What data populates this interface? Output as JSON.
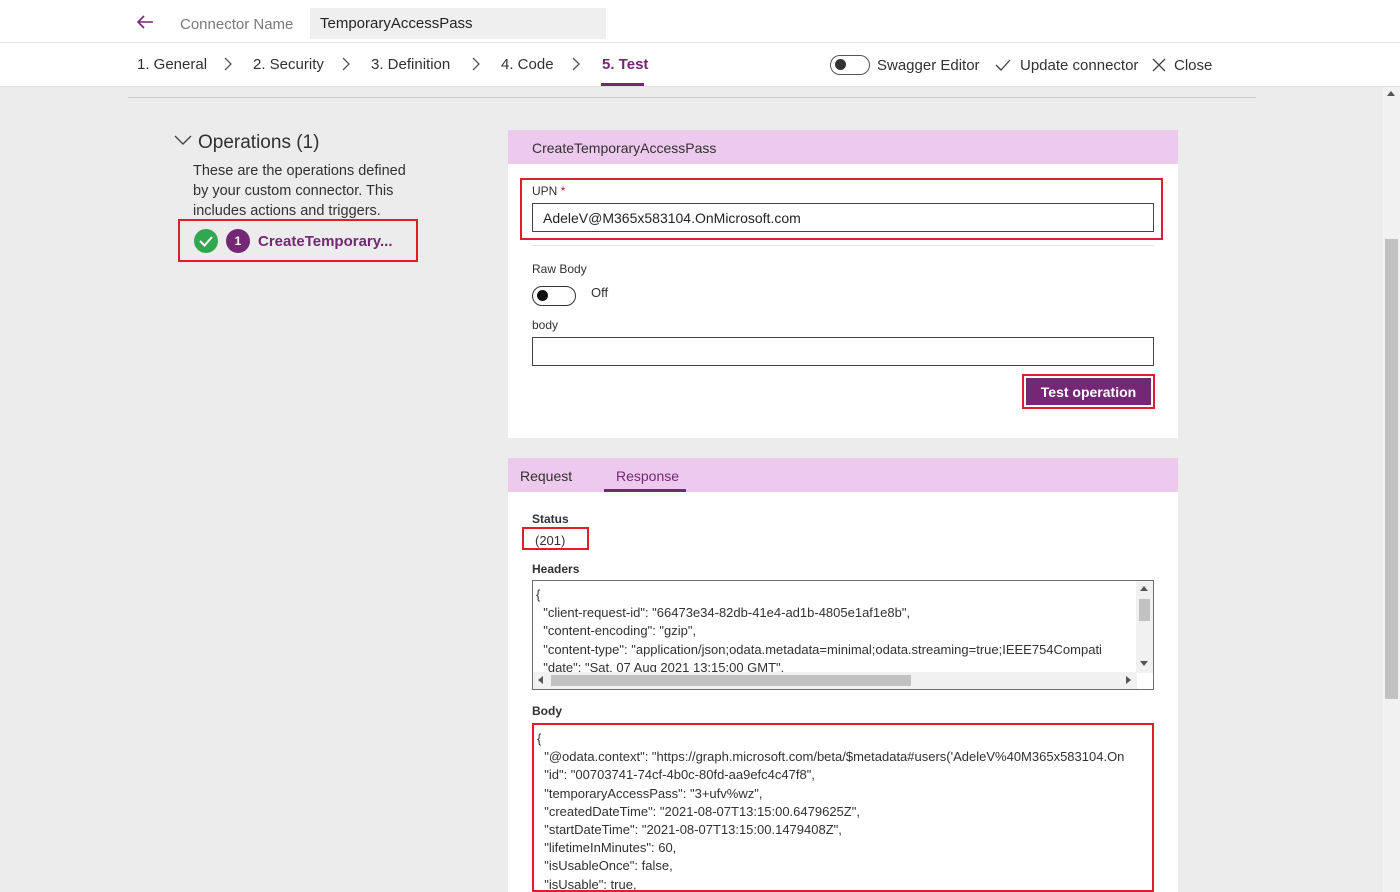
{
  "header": {
    "connector_label": "Connector Name",
    "connector_value": "TemporaryAccessPass"
  },
  "steps": [
    {
      "label": "1. General"
    },
    {
      "label": "2. Security"
    },
    {
      "label": "3. Definition"
    },
    {
      "label": "4. Code"
    },
    {
      "label": "5. Test",
      "active": true
    }
  ],
  "actions": {
    "swagger_label": "Swagger Editor",
    "update_label": "Update connector",
    "close_label": "Close"
  },
  "operations": {
    "title": "Operations (1)",
    "description": "These are the operations defined by your custom connector. This includes actions and triggers.",
    "items": [
      {
        "number": "1",
        "name": "CreateTemporary..."
      }
    ]
  },
  "test_panel": {
    "title": "CreateTemporaryAccessPass",
    "upn_label": "UPN",
    "upn_required": "*",
    "upn_value": "AdeleV@M365x583104.OnMicrosoft.com",
    "raw_body_label": "Raw Body",
    "raw_body_state": "Off",
    "body_label": "body",
    "body_value": "",
    "test_button": "Test operation"
  },
  "response": {
    "tabs": [
      {
        "label": "Request"
      },
      {
        "label": "Response",
        "active": true
      }
    ],
    "status_label": "Status",
    "status_value": "(201)",
    "headers_label": "Headers",
    "headers_lines": [
      "{",
      "  \"client-request-id\": \"66473e34-82db-41e4-ad1b-4805e1af1e8b\",",
      "  \"content-encoding\": \"gzip\",",
      "  \"content-type\": \"application/json;odata.metadata=minimal;odata.streaming=true;IEEE754Compati",
      "  \"date\": \"Sat, 07 Aug 2021 13:15:00 GMT\","
    ],
    "body_label": "Body",
    "body_lines": [
      "{",
      "  \"@odata.context\": \"https://graph.microsoft.com/beta/$metadata#users('AdeleV%40M365x583104.On",
      "  \"id\": \"00703741-74cf-4b0c-80fd-aa9efc4c47f8\",",
      "  \"temporaryAccessPass\": \"3+ufv%wz\",",
      "  \"createdDateTime\": \"2021-08-07T13:15:00.6479625Z\",",
      "  \"startDateTime\": \"2021-08-07T13:15:00.1479408Z\",",
      "  \"lifetimeInMinutes\": 60,",
      "  \"isUsableOnce\": false,",
      "  \"isUsable\": true,"
    ]
  },
  "colors": {
    "accent": "#742774",
    "panel_header": "#edc9ed",
    "highlight": "#e01e2b",
    "success": "#2fa84f"
  }
}
